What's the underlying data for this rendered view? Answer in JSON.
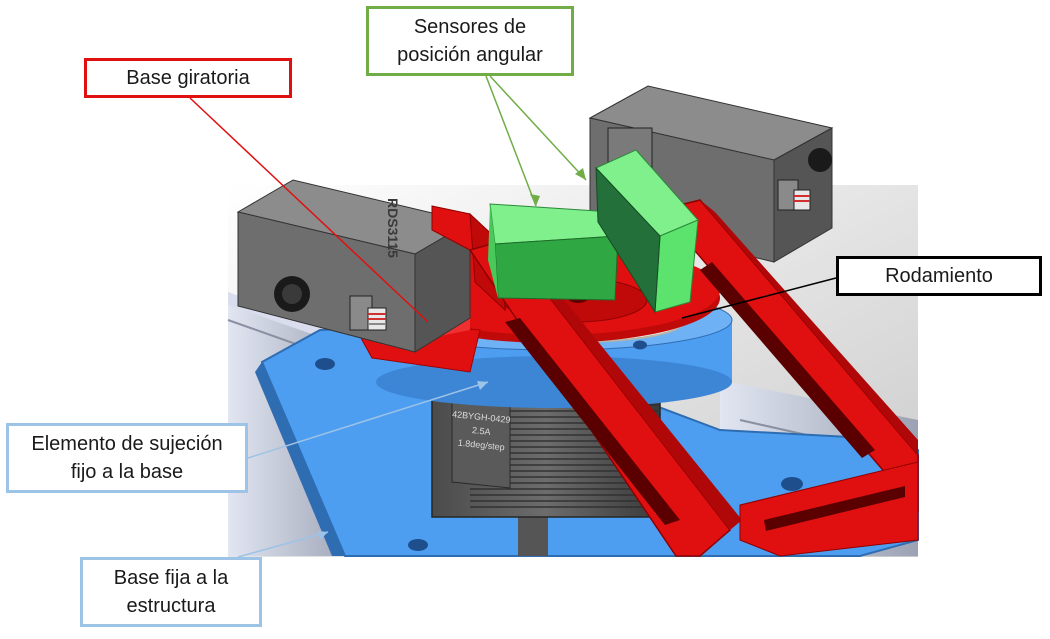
{
  "labels": {
    "sensors_line1": "Sensores de",
    "sensors_line2": "posición angular",
    "base_giratoria": "Base giratoria",
    "rodamiento": "Rodamiento",
    "elemento_line1": "Elemento de sujeción",
    "elemento_line2": "fijo a la base",
    "base_fija_line1": "Base fija a la",
    "base_fija_line2": "estructura"
  },
  "model_text": {
    "servo_mark": "RDS3115",
    "motor_line1": "42BYGH-0429",
    "motor_line2": "2.5A",
    "motor_line3": "1.8deg/step"
  },
  "colors": {
    "sensors_border": "#70ad47",
    "base_giratoria_border": "#e01010",
    "rodamiento_border": "#000000",
    "elemento_border": "#9dc3e6",
    "base_fija_border": "#9dc3e6",
    "red_part": "#e01010",
    "blue_plate": "#4d9ef0",
    "sensor_green": "#5ce36e",
    "servo_grey": "#6e6e6e"
  }
}
